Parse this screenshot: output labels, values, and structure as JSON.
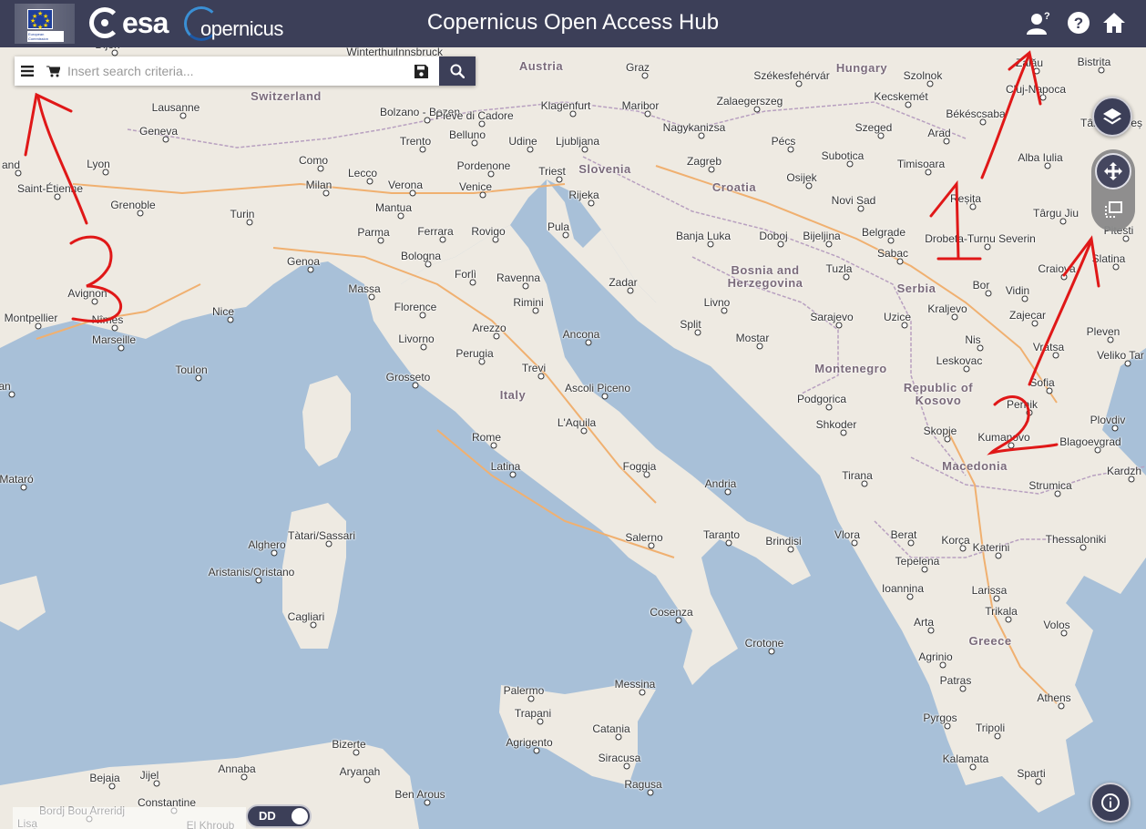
{
  "header": {
    "title": "Copernicus Open Access Hub",
    "esa_logo": "esa",
    "copernicus_logo": "opernicus",
    "eu_logo_text": "European Commission",
    "icons": [
      "user-help-icon",
      "help-icon",
      "home-icon"
    ]
  },
  "search": {
    "placeholder": "Insert search criteria...",
    "value": ""
  },
  "toggle": {
    "label": "DD"
  },
  "annotations": {
    "one": "1",
    "two": "2",
    "three": "3"
  },
  "colors": {
    "header_bg": "#3c3f58",
    "sea": "#a8c0d8",
    "land": "#eeeae2",
    "annotation": "#e01818"
  },
  "map": {
    "countries": [
      {
        "name": "Austria"
      },
      {
        "name": "Switzerland"
      },
      {
        "name": "Hungary"
      },
      {
        "name": "Slovenia"
      },
      {
        "name": "Croatia"
      },
      {
        "name": "Bosnia and Herzegovina"
      },
      {
        "name": "Serbia"
      },
      {
        "name": "Montenegro"
      },
      {
        "name": "Republic of Kosovo"
      },
      {
        "name": "Italy"
      },
      {
        "name": "Macedonia"
      },
      {
        "name": "Greece"
      }
    ],
    "cities": [
      {
        "name": "Dijon"
      },
      {
        "name": "Winterthur"
      },
      {
        "name": "Innsbruck"
      },
      {
        "name": "Graz"
      },
      {
        "name": "Székesfehérvár"
      },
      {
        "name": "Szolnok"
      },
      {
        "name": "Zalău"
      },
      {
        "name": "Bistrita"
      },
      {
        "name": "Lausanne"
      },
      {
        "name": "Bolzano - Bozen"
      },
      {
        "name": "Pieve di Cadore"
      },
      {
        "name": "Klagenfurt"
      },
      {
        "name": "Maribor"
      },
      {
        "name": "Zalaegerszeg"
      },
      {
        "name": "Kecskemét"
      },
      {
        "name": "Cluj-Napoca"
      },
      {
        "name": "Békéscsaba"
      },
      {
        "name": "Târgu Mureș"
      },
      {
        "name": "Geneva"
      },
      {
        "name": "Trento"
      },
      {
        "name": "Belluno"
      },
      {
        "name": "Udine"
      },
      {
        "name": "Ljubljana"
      },
      {
        "name": "Nagykanizsa"
      },
      {
        "name": "Pécs"
      },
      {
        "name": "Szeged"
      },
      {
        "name": "Arad"
      },
      {
        "name": "Lyon"
      },
      {
        "name": "Como"
      },
      {
        "name": "Lecco"
      },
      {
        "name": "Pordenone"
      },
      {
        "name": "Triest"
      },
      {
        "name": "Zagreb"
      },
      {
        "name": "Subotica"
      },
      {
        "name": "Timisoara"
      },
      {
        "name": "Alba Iulia"
      },
      {
        "name": "Saint-Étienne"
      },
      {
        "name": "Milan"
      },
      {
        "name": "Verona"
      },
      {
        "name": "Venice"
      },
      {
        "name": "Rijeka"
      },
      {
        "name": "Osijek"
      },
      {
        "name": "Grenoble"
      },
      {
        "name": "Turin"
      },
      {
        "name": "Mantua"
      },
      {
        "name": "Novi Sad"
      },
      {
        "name": "Reșița"
      },
      {
        "name": "Târgu Jiu"
      },
      {
        "name": "Parma"
      },
      {
        "name": "Ferrara"
      },
      {
        "name": "Rovigo"
      },
      {
        "name": "Pula"
      },
      {
        "name": "Banja Luka"
      },
      {
        "name": "Doboj"
      },
      {
        "name": "Bijeljina"
      },
      {
        "name": "Belgrade"
      },
      {
        "name": "Drobeta-Turnu Severin"
      },
      {
        "name": "Pitesti"
      },
      {
        "name": "Bologna"
      },
      {
        "name": "Sabac"
      },
      {
        "name": "Genoa"
      },
      {
        "name": "Forlì"
      },
      {
        "name": "Ravenna"
      },
      {
        "name": "Tuzla"
      },
      {
        "name": "Craiova"
      },
      {
        "name": "Slatina"
      },
      {
        "name": "Massa"
      },
      {
        "name": "Rimini"
      },
      {
        "name": "Zadar"
      },
      {
        "name": "Bor"
      },
      {
        "name": "Vidin"
      },
      {
        "name": "Avignon"
      },
      {
        "name": "Florence"
      },
      {
        "name": "Livno"
      },
      {
        "name": "Sarajevo"
      },
      {
        "name": "Uzice"
      },
      {
        "name": "Kraljevo"
      },
      {
        "name": "Zajecar"
      },
      {
        "name": "Montpellier"
      },
      {
        "name": "Nîmes"
      },
      {
        "name": "Nice"
      },
      {
        "name": "Arezzo"
      },
      {
        "name": "Split"
      },
      {
        "name": "Ancona"
      },
      {
        "name": "Pleven"
      },
      {
        "name": "Marseille"
      },
      {
        "name": "Livorno"
      },
      {
        "name": "Mostar"
      },
      {
        "name": "Nis"
      },
      {
        "name": "Vratsa"
      },
      {
        "name": "Perugia"
      },
      {
        "name": "Veliko Tar"
      },
      {
        "name": "Toulon"
      },
      {
        "name": "Trevi"
      },
      {
        "name": "Leskovac"
      },
      {
        "name": "Grosseto"
      },
      {
        "name": "Ascoli Piceno"
      },
      {
        "name": "Podgorica"
      },
      {
        "name": "Sofia"
      },
      {
        "name": "Pernik"
      },
      {
        "name": "L'Aquila"
      },
      {
        "name": "Shkoder"
      },
      {
        "name": "Plovdiv"
      },
      {
        "name": "Skopje"
      },
      {
        "name": "Kumanovo"
      },
      {
        "name": "Rome"
      },
      {
        "name": "Blagoevgrad"
      },
      {
        "name": "Latina"
      },
      {
        "name": "Foggia"
      },
      {
        "name": "Tirana"
      },
      {
        "name": "Kardzh"
      },
      {
        "name": "Mataró"
      },
      {
        "name": "Andria"
      },
      {
        "name": "Strumica"
      },
      {
        "name": "Tàtari/Sassari"
      },
      {
        "name": "Vlora"
      },
      {
        "name": "Berat"
      },
      {
        "name": "Korça"
      },
      {
        "name": "Taranto"
      },
      {
        "name": "Salerno"
      },
      {
        "name": "Brindisi"
      },
      {
        "name": "Katerini"
      },
      {
        "name": "Thessaloniki"
      },
      {
        "name": "Alghero"
      },
      {
        "name": "Tepelena"
      },
      {
        "name": "Aristanis/Oristano"
      },
      {
        "name": "Ioannina"
      },
      {
        "name": "Larissa"
      },
      {
        "name": "Trikala"
      },
      {
        "name": "Cagliari"
      },
      {
        "name": "Cosenza"
      },
      {
        "name": "Arta"
      },
      {
        "name": "Volos"
      },
      {
        "name": "Crotone"
      },
      {
        "name": "Agrinio"
      },
      {
        "name": "Patras"
      },
      {
        "name": "Messina"
      },
      {
        "name": "Palermo"
      },
      {
        "name": "Trapani"
      },
      {
        "name": "Athens"
      },
      {
        "name": "Catania"
      },
      {
        "name": "Agrigento"
      },
      {
        "name": "Pyrgos"
      },
      {
        "name": "Tripoli"
      },
      {
        "name": "Bizerte"
      },
      {
        "name": "Siracusa"
      },
      {
        "name": "Kalamata"
      },
      {
        "name": "Aryanah"
      },
      {
        "name": "Sparti"
      },
      {
        "name": "Ragusa"
      },
      {
        "name": "Bejaia"
      },
      {
        "name": "Jijel"
      },
      {
        "name": "Annaba"
      },
      {
        "name": "Ben Arous"
      },
      {
        "name": "Constantine"
      },
      {
        "name": "Bordj Bou Arreridj"
      },
      {
        "name": "El Khroub"
      },
      {
        "name": "Lisa"
      },
      {
        "name": "and"
      },
      {
        "name": "an"
      }
    ]
  }
}
